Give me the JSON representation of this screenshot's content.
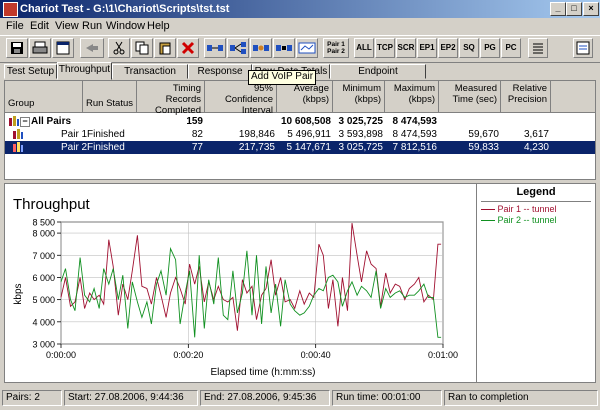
{
  "window": {
    "title": "Chariot Test - G:\\1\\Chariot\\Scripts\\tst.tst",
    "min": "_",
    "max": "□",
    "close": "×"
  },
  "menu": [
    "File",
    "Edit",
    "View",
    "Run",
    "Window",
    "Help"
  ],
  "toolbar": {
    "pair_label": "Pair 1\nPair 2",
    "buttons": [
      "ALL",
      "TCP",
      "SCR",
      "EP1",
      "EP2",
      "SQ",
      "PG",
      "PC"
    ]
  },
  "tooltip": "Add VoIP Pair",
  "tabs": [
    "Test Setup",
    "Throughput",
    "Transaction Rate",
    "Response Time",
    "Raw Data Totals",
    "Endpoint Configuration"
  ],
  "active_tab": "Throughput",
  "grid": {
    "headers": [
      "Group",
      "Run Status",
      "Timing Records Completed",
      "95% Confidence Interval",
      "Average (kbps)",
      "Minimum (kbps)",
      "Maximum (kbps)",
      "Measured Time (sec)",
      "Relative Precision"
    ],
    "rows": [
      {
        "group": "All Pairs",
        "status": "",
        "records": "159",
        "ci": "",
        "avg": "10 608,508",
        "min": "3 025,725",
        "max": "8 474,593",
        "time": "",
        "prec": ""
      },
      {
        "group": "Pair 1",
        "status": "Finished",
        "records": "82",
        "ci": "198,846",
        "avg": "5 496,911",
        "min": "3 593,898",
        "max": "8 474,593",
        "time": "59,670",
        "prec": "3,617"
      },
      {
        "group": "Pair 2",
        "status": "Finished",
        "records": "77",
        "ci": "217,735",
        "avg": "5 147,671",
        "min": "3 025,725",
        "max": "7 812,516",
        "time": "59,833",
        "prec": "4,230"
      }
    ],
    "selected_row": 2,
    "collapse_symbol": "−"
  },
  "colors": {
    "pair1": "#a01030",
    "pair2": "#109020",
    "selection": "#0a246a"
  },
  "chart_data": {
    "type": "line",
    "title": "Throughput",
    "xlabel": "Elapsed time (h:mm:ss)",
    "ylabel": "kbps",
    "xlim": [
      0,
      60
    ],
    "ylim": [
      3000,
      8500
    ],
    "x_ticks": [
      "0:00:00",
      "0:00:20",
      "0:00:40",
      "0:01:00"
    ],
    "x_tick_values": [
      0,
      20,
      40,
      60
    ],
    "y_ticks": [
      "3 000",
      "4 000",
      "5 000",
      "6 000",
      "7 000",
      "8 000",
      "8 500"
    ],
    "y_tick_values": [
      3000,
      4000,
      5000,
      6000,
      7000,
      8000,
      8500
    ],
    "series": [
      {
        "name": "Pair 1 -- tunnel",
        "x": [
          0,
          0.7,
          1.5,
          2.2,
          3,
          3.7,
          4.5,
          5.2,
          6,
          6.7,
          7.5,
          8.2,
          9,
          9.7,
          10.5,
          11.2,
          12,
          12.7,
          13.5,
          14.2,
          15,
          15.7,
          16.5,
          17.2,
          18,
          18.7,
          19.5,
          20.2,
          21,
          21.7,
          22.5,
          23.2,
          24,
          24.7,
          25.5,
          26.2,
          27,
          27.7,
          28.5,
          29.2,
          30,
          30.7,
          31.5,
          32.2,
          33,
          33.7,
          34.5,
          35.2,
          36,
          36.7,
          37.5,
          38.2,
          39,
          39.7,
          40.5,
          41.2,
          42,
          42.7,
          43.5,
          44.2,
          45,
          45.7,
          46.5,
          47.2,
          48,
          48.7,
          49.5,
          50.2,
          51,
          51.7,
          52.5,
          53.2,
          54,
          54.7,
          55.5,
          56.2,
          57,
          57.7,
          58.5,
          59.2,
          59.7
        ],
        "y": [
          5100,
          6000,
          4700,
          4900,
          6000,
          4600,
          5300,
          5000,
          5200,
          4800,
          7700,
          6500,
          4300,
          5700,
          5000,
          6300,
          7900,
          5600,
          5500,
          4800,
          6000,
          5200,
          4200,
          5300,
          6000,
          5500,
          4800,
          6600,
          5700,
          6500,
          4900,
          5800,
          5000,
          5600,
          5000,
          4900,
          5100,
          3600,
          5900,
          5300,
          5600,
          4100,
          5200,
          5500,
          6800,
          5200,
          6000,
          4900,
          5000,
          4600,
          5400,
          4800,
          5300,
          5100,
          7500,
          7000,
          4600,
          5900,
          3800,
          6000,
          4500,
          8450,
          7000,
          5800,
          7200,
          6600,
          6400,
          4700,
          6200,
          5300,
          5700,
          5600,
          5000,
          5500,
          5700,
          6000,
          4900,
          5200,
          5000,
          7500,
          7500
        ]
      },
      {
        "name": "Pair 2 -- tunnel",
        "x": [
          0,
          0.7,
          1.5,
          2.2,
          3,
          3.7,
          4.5,
          5.2,
          6,
          6.7,
          7.5,
          8.2,
          9,
          9.7,
          10.5,
          11.2,
          12,
          12.7,
          13.5,
          14.2,
          15,
          15.7,
          16.5,
          17.2,
          18,
          18.7,
          19.5,
          20.2,
          21,
          21.7,
          22.5,
          23.2,
          24,
          24.7,
          25.5,
          26.2,
          27,
          27.7,
          28.5,
          29.2,
          30,
          30.7,
          31.5,
          32.2,
          33,
          33.7,
          34.5,
          35.2,
          36,
          36.7,
          37.5,
          38.2,
          39,
          39.7,
          40.5,
          41.2,
          42,
          42.7,
          43.5,
          44.2,
          45,
          45.7,
          46.5,
          47.2,
          48,
          48.7,
          49.5,
          50.2,
          51,
          51.7,
          52.5,
          53.2,
          54,
          54.7,
          55.5,
          56.2,
          57,
          57.7,
          58.5,
          59.2,
          59.7
        ],
        "y": [
          5800,
          6400,
          5000,
          4500,
          6900,
          5200,
          4900,
          5500,
          4600,
          6400,
          5700,
          6400,
          5000,
          6100,
          3700,
          5800,
          4900,
          4200,
          4900,
          3900,
          5700,
          6300,
          5200,
          7300,
          6800,
          3900,
          5300,
          6300,
          3300,
          7000,
          3700,
          5900,
          4800,
          6900,
          4300,
          4100,
          6300,
          4400,
          5300,
          7200,
          4300,
          7000,
          3900,
          6500,
          4400,
          5700,
          3800,
          5900,
          4800,
          4500,
          4300,
          4400,
          4700,
          5200,
          5500,
          5400,
          6000,
          6100,
          5800,
          4700,
          5400,
          5800,
          5200,
          5600,
          5400,
          5100,
          6300,
          4600,
          5500,
          5100,
          5300,
          5400,
          5100,
          5200,
          5200,
          5400,
          5700,
          5100,
          5100,
          3300,
          3300
        ]
      }
    ]
  },
  "legend": {
    "title": "Legend",
    "items": [
      "Pair 1 -- tunnel",
      "Pair 2 -- tunnel"
    ]
  },
  "status": [
    "Pairs: 2",
    "Start: 27.08.2006, 9:44:36",
    "End: 27.08.2006, 9:45:36",
    "Run time: 00:01:00",
    "Ran to completion"
  ]
}
